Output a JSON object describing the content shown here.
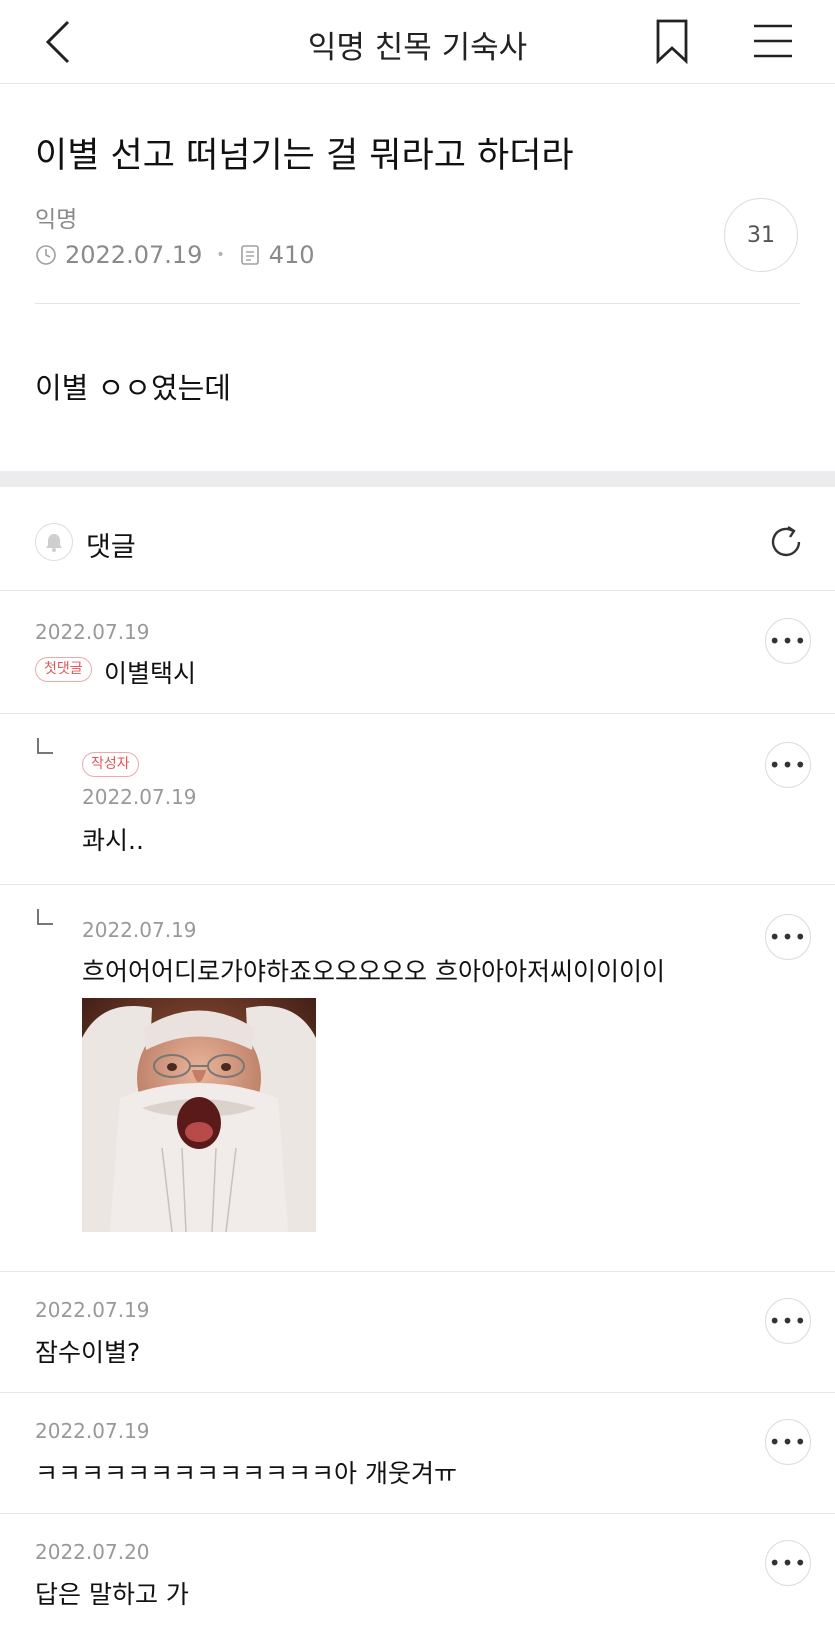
{
  "header": {
    "title": "익명 친목 기숙사",
    "back_icon": "chevron-left-icon",
    "bookmark_icon": "bookmark-icon",
    "menu_icon": "hamburger-menu-icon"
  },
  "post": {
    "title": "이별 선고 떠넘기는 걸 뭐라고 하더라",
    "author": "익명",
    "date": "2022.07.19",
    "views": "410",
    "like_count": "31",
    "body": "이별 ㅇㅇ였는데"
  },
  "comments_section": {
    "label": "댓글",
    "bell_icon": "bell-icon",
    "refresh_icon": "refresh-icon"
  },
  "comments": [
    {
      "date": "2022.07.19",
      "badge": "첫댓글",
      "text": "이별택시"
    },
    {
      "date": "2022.07.19",
      "badge": "작성자",
      "text": "콰시..",
      "reply": true
    },
    {
      "date": "2022.07.19",
      "text": "흐어어어디로가야하죠오오오오오 흐아아아저씨이이이이",
      "reply": true,
      "image": "dumbledore-shouting-sticker"
    },
    {
      "date": "2022.07.19",
      "text": "잠수이별?"
    },
    {
      "date": "2022.07.19",
      "text": "ㅋㅋㅋㅋㅋㅋㅋㅋㅋㅋㅋㅋㅋ아 개웃겨ㅠ"
    },
    {
      "date": "2022.07.20",
      "text": "답은 말하고 가"
    }
  ],
  "more_label": "•••",
  "colors": {
    "badge_red": "#e05858",
    "meta_gray": "#8a8a8a",
    "divider": "#e6e6e6",
    "section_gap": "#ececee"
  }
}
